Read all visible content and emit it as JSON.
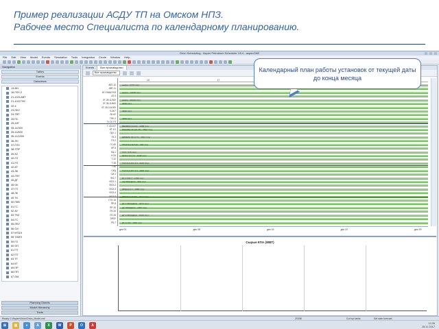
{
  "slide": {
    "title_line1": "Пример реализации АСДУ ТП на Омском НПЗ.",
    "title_line2": "Рабочее место Специалиста по календарному планированию."
  },
  "app": {
    "window_title": "Orion Scheduling - Aspen Petroleum Scheduler V8.4 - aspenONE",
    "menu": [
      "File",
      "Edit",
      "View",
      "Model",
      "Events",
      "Simulation",
      "Tools",
      "Integration",
      "Crude",
      "Window",
      "Help"
    ],
    "nav": {
      "header": "Navigation",
      "buttons": [
        "Tables",
        "Events",
        "Dataviews"
      ],
      "tree_items": [
        "13-ВН",
        "16-ГФУ-2",
        "21-10/3-АВТ",
        "21-10/3 ГФУ",
        "22-4",
        "23-ПКУ",
        "24-ТВТ",
        "25 ГБ",
        "25-4ЛГ",
        "35-11/300",
        "35-11/600",
        "35-11/1000",
        "36-ЛЧ",
        "37-ГПЗ",
        "38-ТПР",
        "39-КС",
        "40-ГО",
        "41-ГО",
        "42-КТ",
        "43-ЛК",
        "44-ГФУ",
        "45 ДГ",
        "46 ОК",
        "47 ГП",
        "48 ЛК",
        "49 ТК",
        "50 ПКВ",
        "51 ГС",
        "52 АУ",
        "53 ТКС",
        "54-ГС",
        "55-ПКУ",
        "56 СИ",
        "57 МТБЭ",
        "58 ТАМЭ",
        "59 ГО",
        "60 ОП",
        "61 ПТ",
        "62 ПТ",
        "63 ТТ",
        "64 КТ",
        "65 ПР",
        "66 ПП",
        "67 ОМ"
      ],
      "bottom_buttons": [
        "Planning Sheets",
        "Model Hierarchy",
        "Tools"
      ]
    },
    "tabs": [
      "Events",
      "Все производство"
    ],
    "filter_value": "Все производство",
    "gantt": {
      "top_axis": [
        "10",
        "17",
        "24",
        "31"
      ],
      "bottom_axis": [
        "дек 01",
        "дек 08",
        "дек 15",
        "дек 22",
        "дек 29"
      ],
      "row_labels": [
        "АВТ-10",
        "АВТ-11",
        "АТ-9 ВАКУУМ",
        "АТ-9",
        "ЛГ-35-11/300",
        "ЛГ-35-11/600",
        "ЛГ-35-11/1000",
        "Л-24/7",
        "ЛК-6У",
        "ГФУ-2",
        "ТУ-20 ГП",
        "Г-43-107",
        "КТ-1/1",
        "ГДУ-1",
        "ГК-3",
        "ГО-2",
        "ГС-60",
        "КР-5",
        "КЦ-1",
        "Н-24",
        "Т-22",
        "Т-36",
        "Т-40",
        "СКЦ",
        "СИ-1",
        "ФО-7",
        "ФОЗ-1",
        "ФОЗ-2",
        "ФОЗ-3",
        "ФОЗ-4",
        "ФОЗ-5",
        "ГПУ-15",
        "ПР-8",
        "ПР-10",
        "ПУ-20",
        "ПУ-25",
        "ЭЛОУ",
        "РК-7"
      ],
      "bar_texts": [
        "нефть - 6776 т/сут",
        "нефть - 10158 т/сут",
        "нефть - 11210 т/сут",
        "4698 т/сут",
        "4698 т/сут",
        "4698 т/сут",
        "ВЕКМИН 43-101 - 4088 т/сут",
        "БЕНЗИН 43-101 ИП - 3804 т/сут",
        "ДИЗЕЛЬ 35-11 ГС - 3814 т/сут",
        "ПРОПАН-БУТАН - 960 т/сут",
        "ГСП - 575 т/сут",
        "ФОЗ-1 6.2 ТО - 4448 т/сут",
        "ГОУ 6.2 НТО 3.0 - 2145 т/сут",
        "ГОУ 6.2 НТО 3.0 - 1920 т/сут",
        "БГ 1 ГРК-7 - 1765 т/сут",
        "КЦ ПРОЦЕСС - 896 т/сут",
        "ФРЕОН 1.7 - 1880 т/сут",
        "ФРЕОН 1.5 ТТУ - 3212 т/сут",
        "ДТ 1 ПРОЦЕСС - 4070 т/сут",
        "ДТ ПРОЦЕСС - 2097 т/сут",
        "ДТ 2 ПРОЦЕСС - 1508 т/сут",
        "ДТ 2 ГРК - 1596 т/сут"
      ]
    },
    "lower_chart_title": "Сырые КПА (WBT)",
    "status_text": "Ready   C:\\Aspen\\Orion\\Orion_Model.xml",
    "status_right": [
      "2030Б",
      "Cut top tanks",
      "Set date forecast"
    ],
    "taskbar_icons": [
      "windows-start",
      "explorer",
      "chrome",
      "aspen",
      "excel",
      "word",
      "powerpoint",
      "outlook",
      "pdf"
    ],
    "clock_time": "12:26",
    "clock_date": "28.11.2017"
  },
  "callout": {
    "text": "Календарный план работы установок от текущей даты до конца месяца"
  }
}
